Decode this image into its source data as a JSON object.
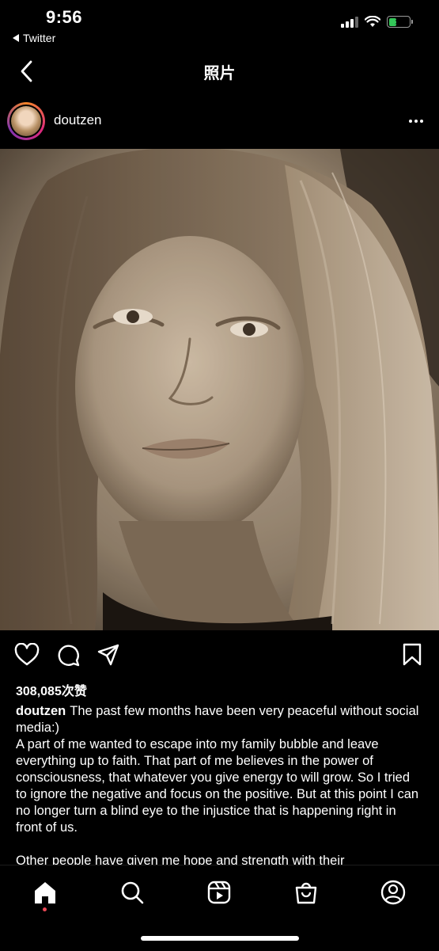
{
  "status_bar": {
    "time": "9:56",
    "back_app": "Twitter",
    "icons": [
      "cellular-signal-icon",
      "wifi-icon",
      "battery-charging-icon"
    ],
    "battery_level": 0.4,
    "battery_color": "#34c759"
  },
  "nav": {
    "title": "照片",
    "back_icon": "chevron-left-icon"
  },
  "post": {
    "username": "doutzen",
    "more_icon": "ellipsis-icon",
    "photo": "sepia-selfie-photo",
    "actions": [
      "heart-icon",
      "comment-icon",
      "share-icon",
      "bookmark-icon"
    ],
    "likes": "308,085次赞",
    "caption": {
      "username": "doutzen",
      "first_line": "The past few months have been very peaceful without social media:)",
      "paragraph": "A part of me wanted to escape into my family bubble and leave everything up to faith. That part of me believes in the power of consciousness, that whatever you give energy to will grow. So I tried to ignore the negative and focus on the positive. But at this point I can no longer turn a blind eye to the injustice that is happening right in front of us.",
      "cut_line": "Other people have given me hope and strength with their"
    }
  },
  "tab_bar": {
    "items": [
      "home-icon",
      "search-icon",
      "reels-icon",
      "shop-icon",
      "profile-icon"
    ],
    "active": "home-icon",
    "notification_color": "#ed4956"
  }
}
